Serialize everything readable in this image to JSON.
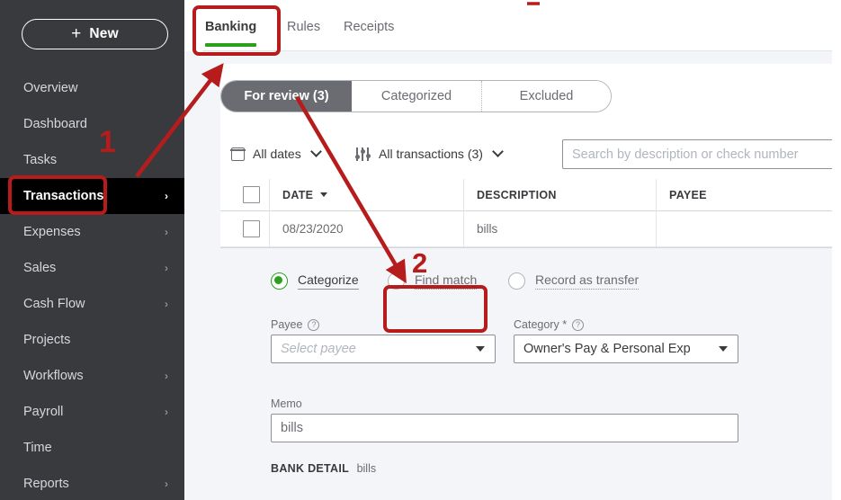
{
  "sidebar": {
    "new_button": {
      "label": "New",
      "icon": "plus-icon"
    },
    "items": [
      {
        "label": "Overview",
        "has_chevron": false,
        "active": false
      },
      {
        "label": "Dashboard",
        "has_chevron": false,
        "active": false
      },
      {
        "label": "Tasks",
        "has_chevron": false,
        "active": false
      },
      {
        "label": "Transactions",
        "has_chevron": true,
        "active": true
      },
      {
        "label": "Expenses",
        "has_chevron": true,
        "active": false
      },
      {
        "label": "Sales",
        "has_chevron": true,
        "active": false
      },
      {
        "label": "Cash Flow",
        "has_chevron": true,
        "active": false
      },
      {
        "label": "Projects",
        "has_chevron": false,
        "active": false
      },
      {
        "label": "Workflows",
        "has_chevron": true,
        "active": false
      },
      {
        "label": "Payroll",
        "has_chevron": true,
        "active": false
      },
      {
        "label": "Time",
        "has_chevron": false,
        "active": false
      },
      {
        "label": "Reports",
        "has_chevron": true,
        "active": false
      }
    ],
    "chevron_glyph": "›",
    "bg_color": "#393a3d",
    "active_bg_color": "#000000"
  },
  "tabs": [
    {
      "label": "Banking",
      "active": true
    },
    {
      "label": "Rules",
      "active": false
    },
    {
      "label": "Receipts",
      "active": false
    }
  ],
  "tab_accent_color": "#2ca01c",
  "segmented_control": [
    {
      "label": "For review (3)",
      "active": true
    },
    {
      "label": "Categorized",
      "active": false
    },
    {
      "label": "Excluded",
      "active": false
    }
  ],
  "filters": {
    "date_filter": {
      "label": "All dates",
      "icon": "calendar-icon",
      "chevron": "chevron-down-icon"
    },
    "type_filter": {
      "label": "All transactions (3)",
      "icon": "sliders-icon",
      "chevron": "chevron-down-icon"
    },
    "search": {
      "placeholder": "Search by description or check number",
      "value": ""
    }
  },
  "table": {
    "columns": [
      {
        "key": "date",
        "label": "DATE",
        "sorted": true
      },
      {
        "key": "description",
        "label": "DESCRIPTION",
        "sorted": false
      },
      {
        "key": "payee",
        "label": "PAYEE",
        "sorted": false
      }
    ],
    "rows": [
      {
        "date": "08/23/2020",
        "description": "bills",
        "payee": ""
      }
    ]
  },
  "detail_panel": {
    "radio_options": [
      {
        "label": "Categorize",
        "selected": true
      },
      {
        "label": "Find match",
        "selected": false
      },
      {
        "label": "Record as transfer",
        "selected": false
      }
    ],
    "payee_field": {
      "label": "Payee",
      "help": "?",
      "value": "",
      "placeholder": "Select payee"
    },
    "category_field": {
      "label": "Category *",
      "help": "?",
      "value": "Owner's Pay & Personal Exp"
    },
    "memo_field": {
      "label": "Memo",
      "value": "bills"
    },
    "bank_detail": {
      "key": "BANK DETAIL",
      "value": "bills"
    },
    "selected_radio_color": "#2ca01c"
  },
  "annotations": {
    "color": "#b71c1c",
    "markers": [
      {
        "number": "1"
      },
      {
        "number": "2"
      }
    ]
  }
}
